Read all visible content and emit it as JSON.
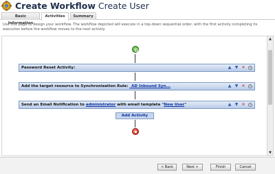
{
  "window": {
    "title_bold": "Create Workflow",
    "title_rest": "Create User"
  },
  "tabs": [
    {
      "label": "Basic Information",
      "active": false
    },
    {
      "label": "Activities",
      "active": true
    },
    {
      "label": "Summary",
      "active": false
    }
  ],
  "intro_text": "Use this page to design your workflow. The workflow depicted will execute in a top-down sequential order, with the first activity completing its execution before the workflow moves to the next activity.",
  "activities": [
    {
      "text": "Password Reset Activity:"
    },
    {
      "prefix": "Add the target resource to Synchronization Rule:",
      "link": "_AD Inbound Syn..."
    },
    {
      "prefix": "Send an Email Notification to",
      "link": "administrator",
      "middle": "with email template \"",
      "link2": "New User",
      "suffix": "\""
    }
  ],
  "activity_icons": [
    "move-up-icon",
    "move-down-icon",
    "delete-icon",
    "settings-icon"
  ],
  "add_activity_label": "Add Activity",
  "buttons": {
    "back": "< Back",
    "next": "Next >",
    "finish": "Finish",
    "cancel": "Cancel"
  }
}
